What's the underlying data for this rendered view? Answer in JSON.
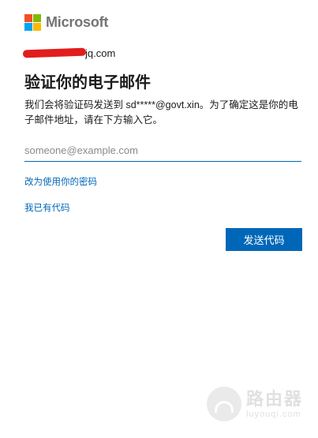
{
  "brand": {
    "name": "Microsoft",
    "colors": [
      "#f25022",
      "#7fba00",
      "#00a4ef",
      "#ffb900"
    ]
  },
  "identity": {
    "account_suffix": "jq.com",
    "redacted": true,
    "redact_color": "#e11d1d"
  },
  "page": {
    "title": "验证你的电子邮件",
    "description": "我们会将验证码发送到 sd*****@govt.xin。为了确定这是你的电子邮件地址，请在下方输入它。"
  },
  "email": {
    "placeholder": "someone@example.com",
    "value": ""
  },
  "links": {
    "use_password": "改为使用你的密码",
    "have_code": "我已有代码"
  },
  "buttons": {
    "send_code": "发送代码"
  },
  "colors": {
    "accent": "#0067b8"
  },
  "watermark": {
    "title": "路由器",
    "url": "luyouqi.com",
    "icon": "router-logo-icon"
  }
}
